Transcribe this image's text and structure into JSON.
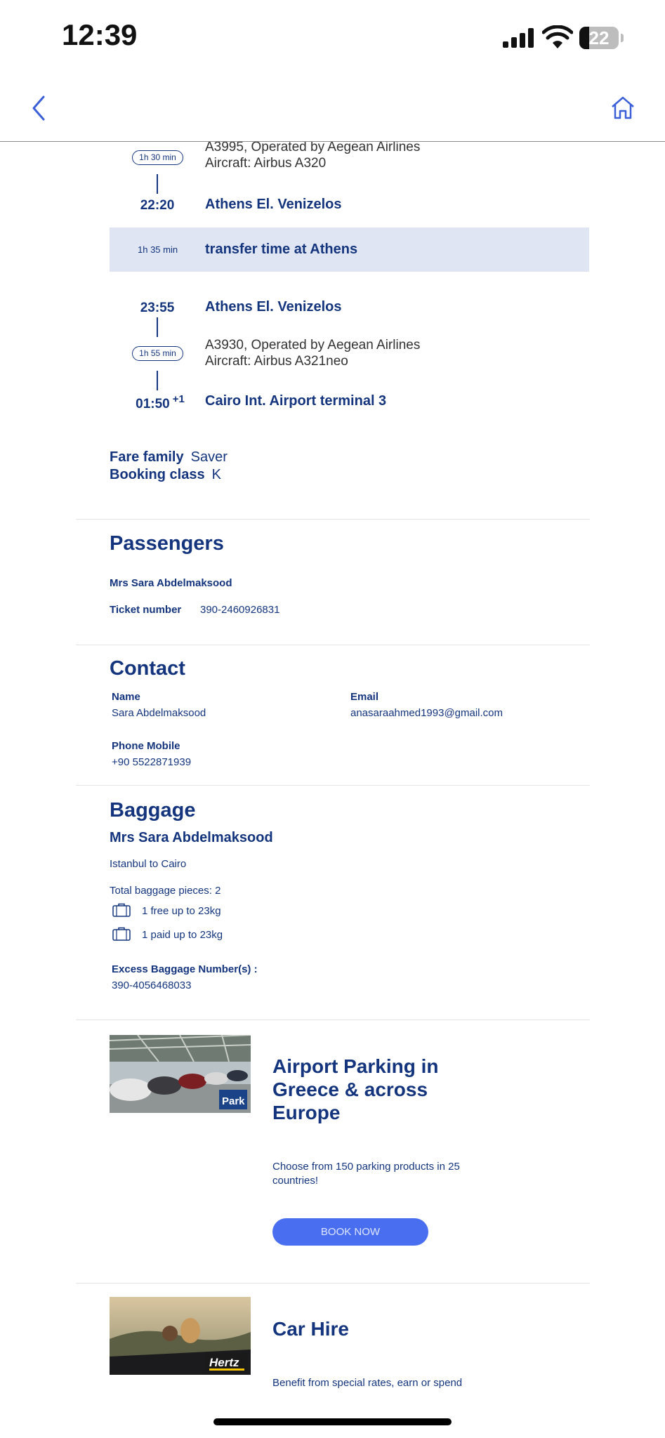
{
  "status": {
    "time": "12:39",
    "battery": "22"
  },
  "itinerary": {
    "seg1": {
      "duration": "1h 30 min",
      "flight": "A3995, Operated by Aegean Airlines",
      "aircraft": "Aircraft: Airbus A320",
      "arr_time": "22:20",
      "arr_airport": "Athens El. Venizelos"
    },
    "transfer": {
      "time": "1h 35 min",
      "label": "transfer time at Athens"
    },
    "seg2": {
      "dep_time": "23:55",
      "dep_airport": "Athens El. Venizelos",
      "duration": "1h 55 min",
      "flight": "A3930, Operated by Aegean Airlines",
      "aircraft": "Aircraft: Airbus A321neo",
      "arr_time": "01:50",
      "day_offset": "+1",
      "arr_airport": "Cairo Int. Airport terminal 3"
    },
    "fare_family_label": "Fare family",
    "fare_family": "Saver",
    "booking_class_label": "Booking class",
    "booking_class": "K"
  },
  "passengers": {
    "title": "Passengers",
    "name": "Mrs Sara Abdelmaksood",
    "ticket_label": "Ticket number",
    "ticket": "390-2460926831"
  },
  "contact": {
    "title": "Contact",
    "name_label": "Name",
    "name": "Sara Abdelmaksood",
    "email_label": "Email",
    "email": "anasaraahmed1993@gmail.com",
    "phone_label": "Phone Mobile",
    "phone": "+90 5522871939"
  },
  "baggage": {
    "title": "Baggage",
    "passenger": "Mrs Sara Abdelmaksood",
    "route": "Istanbul to Cairo",
    "total": "Total baggage pieces: 2",
    "items": [
      "1 free up to 23kg",
      "1 paid up to 23kg"
    ],
    "excess_label": "Excess Baggage Number(s) :",
    "excess": "390-4056468033"
  },
  "promos": {
    "parking": {
      "title": "Airport Parking in Greece & across Europe",
      "text": "Choose from 150 parking products in 25 countries!",
      "button": "BOOK NOW",
      "logo": "Park"
    },
    "car": {
      "title": "Car Hire",
      "text": "Benefit from special rates, earn or spend",
      "logo": "Hertz"
    }
  },
  "colors": {
    "primary": "#14357d",
    "accent": "#4a6ef0",
    "transfer_bg": "#dfe5f2"
  }
}
